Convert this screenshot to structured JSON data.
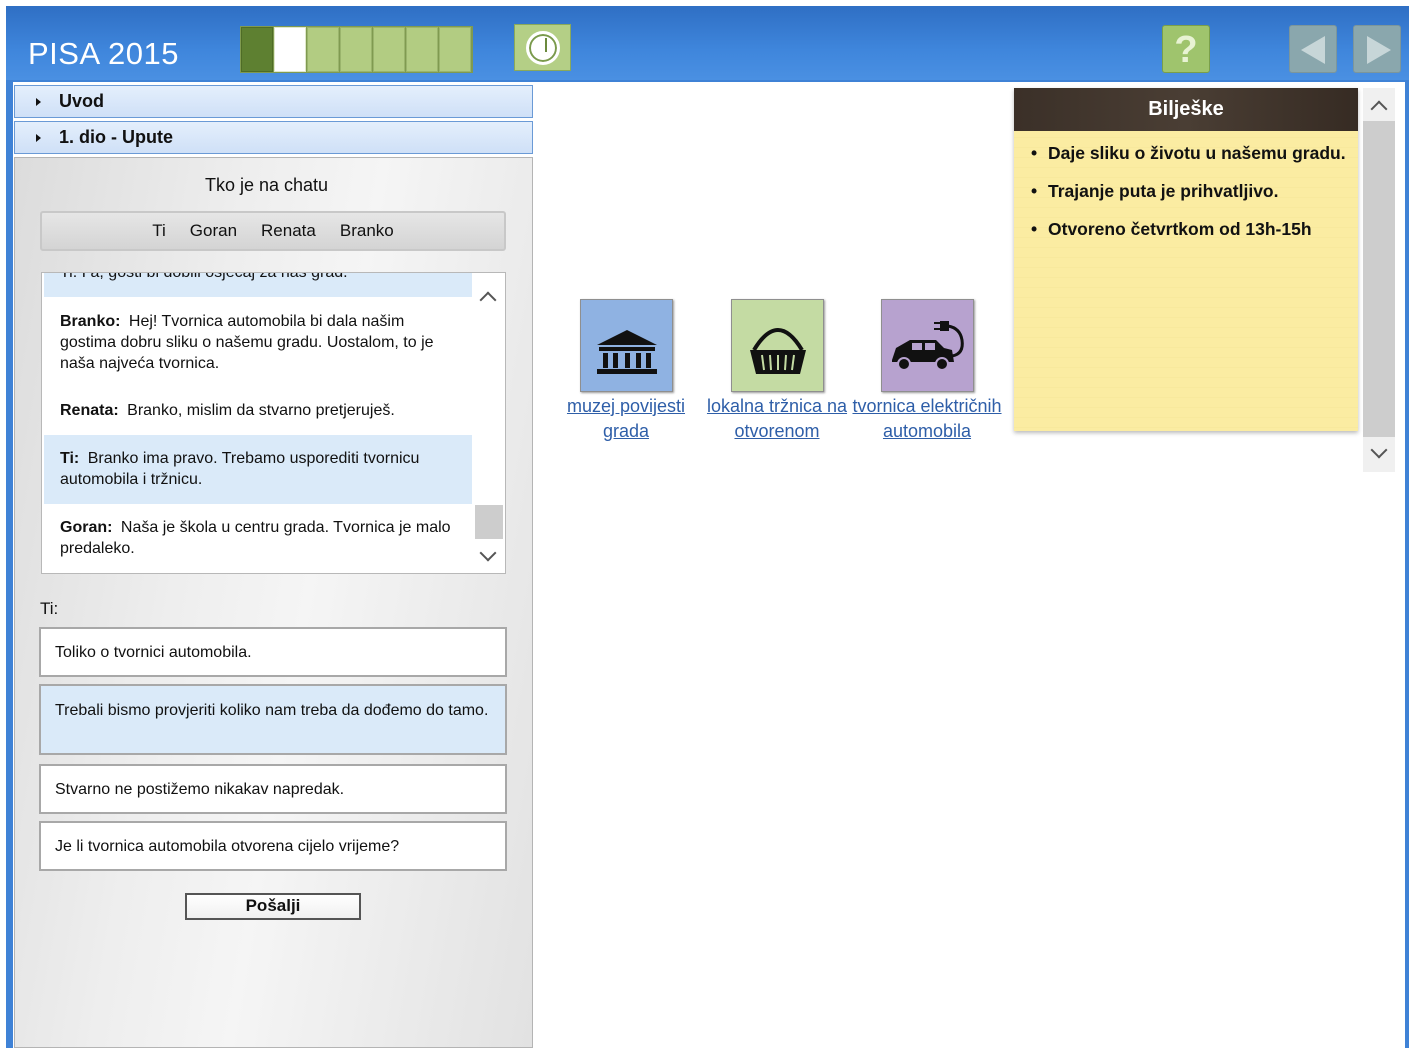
{
  "app": {
    "title": "PISA 2015"
  },
  "progress": {
    "total": 7,
    "completed": 1,
    "current": 2
  },
  "accordion": [
    {
      "label": "Uvod"
    },
    {
      "label": "1. dio - Upute"
    }
  ],
  "chat": {
    "title": "Tko je na chatu",
    "participants": [
      "Ti",
      "Goran",
      "Renata",
      "Branko"
    ],
    "cutoff_line": "Ti: I a, gosti bi dobili osjećaj za naš grad.",
    "messages": [
      {
        "speaker": "Branko:",
        "text": "Hej! Tvornica automobila bi dala našim gostima dobru sliku o našemu gradu. Uostalom, to je naša najveća tvornica."
      },
      {
        "speaker": "Renata:",
        "text": "Branko, mislim da stvarno pretjeruješ."
      },
      {
        "speaker": "Ti:",
        "text": "Branko ima pravo. Trebamo usporediti tvornicu automobila i tržnicu."
      },
      {
        "speaker": "Goran:",
        "text": "Naša je škola u centru grada. Tvornica je malo predaleko."
      }
    ],
    "reply_label": "Ti:",
    "options": [
      "Toliko o tvornici automobila.",
      "Trebali bismo provjeriti koliko nam treba da dođemo do tamo.",
      "Stvarno ne postižemo nikakav napredak.",
      "Je li tvornica automobila otvorena cijelo vrijeme?"
    ],
    "send_label": "Pošalji"
  },
  "places": [
    {
      "label": "muzej povijesti grada",
      "icon": "museum-icon",
      "color": "#8fb2e2"
    },
    {
      "label": "lokalna tržnica na otvorenom",
      "icon": "basket-icon",
      "color": "#c4dba3"
    },
    {
      "label": "tvornica električnih automobila",
      "icon": "electric-car-icon",
      "color": "#b7a2cf"
    }
  ],
  "notes": {
    "title": "Bilješke",
    "items": [
      "Daje sliku o životu u našemu gradu.",
      "Trajanje puta je prihvatljivo.",
      "Otvoreno četvrtkom od 13h-15h"
    ]
  },
  "colors": {
    "header": "#3f82d6",
    "progress_done": "#5e8031",
    "progress_todo": "#b2cc82",
    "selected": "#daeaf9",
    "notes_bg": "#fbeca2"
  }
}
